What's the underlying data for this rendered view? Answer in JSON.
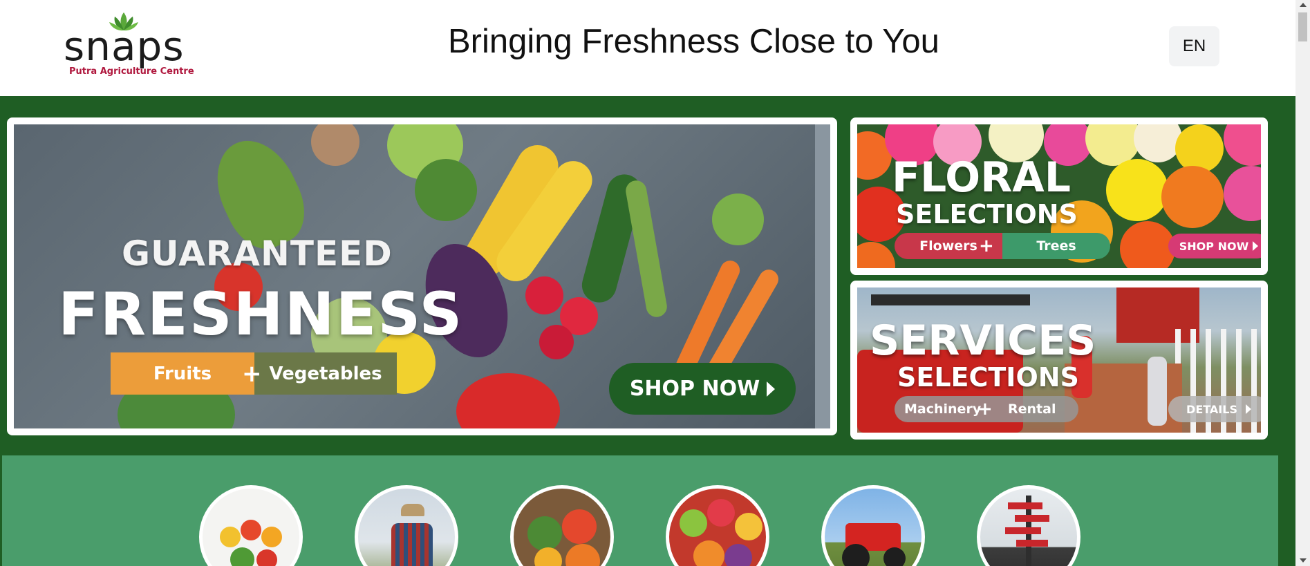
{
  "header": {
    "logo_word": "snaps",
    "logo_subtitle": "Putra Agriculture Centre",
    "tagline": "Bringing Freshness Close to You",
    "language_button": "EN"
  },
  "hero": {
    "main_banner": {
      "headline_small": "GUARANTEED",
      "headline_large": "FRESHNESS",
      "tag_left": "Fruits",
      "tag_plus": "+",
      "tag_right": "Vegetables",
      "cta": "SHOP NOW"
    },
    "floral_banner": {
      "headline_large": "FLORAL",
      "headline_small": "SELECTIONS",
      "tag_left": "Flowers",
      "tag_plus": "+",
      "tag_right": "Trees",
      "cta": "SHOP NOW"
    },
    "services_banner": {
      "headline_large": "SERVICES",
      "headline_small": "SELECTIONS",
      "tag_left": "Machinery",
      "tag_plus": "+",
      "tag_right": "Rental",
      "cta": "DETAILS"
    }
  },
  "categories": [
    {
      "icon": "fruits-vegetables-image"
    },
    {
      "icon": "farmer-tablet-image"
    },
    {
      "icon": "vegetable-basket-image"
    },
    {
      "icon": "fruit-assortment-image"
    },
    {
      "icon": "red-tractor-image"
    },
    {
      "icon": "signpost-image"
    }
  ],
  "colors": {
    "brand_dark_green": "#1f5e24",
    "category_band_green": "#4a9d6b",
    "logo_red": "#b0183e",
    "fruits_orange": "#ec9d3a",
    "floral_pink": "#d63a74"
  }
}
